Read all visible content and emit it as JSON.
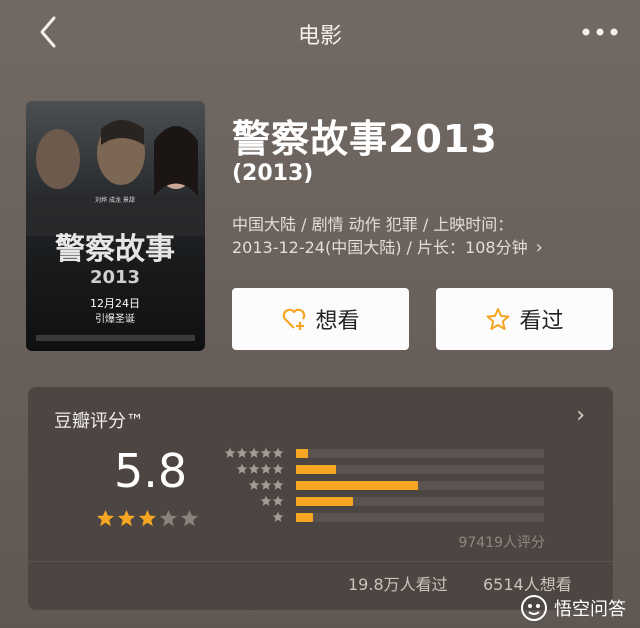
{
  "header": {
    "title": "电影",
    "back_icon": "chevron-left-icon",
    "more_icon": "ellipsis-icon"
  },
  "poster": {
    "title_art": "警察故事",
    "year_art": "2013",
    "date_line": "12月24日",
    "tagline": "引爆圣诞",
    "top_names": [
      "刘烨",
      "成龙",
      "景甜"
    ]
  },
  "movie": {
    "title": "警察故事2013",
    "year": "(2013)",
    "meta_line1": "中国大陆 / 剧情 动作 犯罪 / 上映时间：",
    "meta_line2": "2013-12-24(中国大陆) / 片长：108分钟"
  },
  "actions": {
    "want_label": "想看",
    "seen_label": "看过"
  },
  "rating": {
    "section_title": "豆瓣评分™",
    "score": "5.8",
    "score_stars": 3,
    "distribution": [
      {
        "stars": 5,
        "fraction": 0.05
      },
      {
        "stars": 4,
        "fraction": 0.16
      },
      {
        "stars": 3,
        "fraction": 0.49
      },
      {
        "stars": 2,
        "fraction": 0.23
      },
      {
        "stars": 1,
        "fraction": 0.07
      }
    ],
    "rating_count": "97419人评分",
    "seen_count": "19.8万人看过",
    "want_count": "6514人想看"
  },
  "colors": {
    "accent": "#f5a623",
    "card_bg": "#4c4541",
    "page_bg": "#6b625d"
  },
  "watermark": {
    "text": "悟空问答"
  }
}
